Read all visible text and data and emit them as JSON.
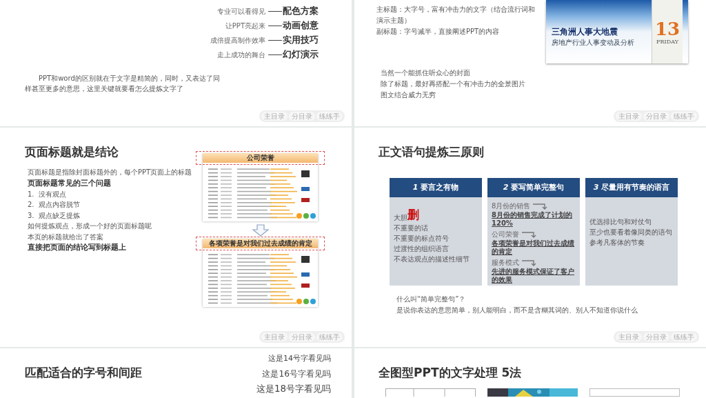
{
  "slides": [
    {
      "kind": "agenda",
      "items": [
        {
          "note": "专业可以看得见",
          "label": "配色方案"
        },
        {
          "note": "让PPT亮起来",
          "label": "动画创意"
        },
        {
          "note": "成倍提高制作效率",
          "label": "实用技巧"
        },
        {
          "note": "走上成功的舞台",
          "label": "幻灯演示"
        }
      ],
      "paragraph": "PPT和word的区别就在于文字是精简的，同时，又表达了同样甚至更多的意思，这里关键就要看怎么提炼文字了",
      "nav": [
        "主目录",
        "分目录",
        "练练手"
      ]
    },
    {
      "kind": "cover",
      "lines": [
        "主标题：大字号，富有冲击力的文字（结合流行词和演示主题）",
        "副标题：字号减半，直接阐述PPT的内容"
      ],
      "cover": {
        "title": "三角洲人事大地震",
        "subtitle": "房地产行业人事变动及分析",
        "day": "13",
        "weekday": "FRIDAY"
      },
      "notes": [
        "当然一个能抓住听众心的封面",
        "除了标题，最好再搭配一个有冲击力的全景图片",
        "图文结合威力无穷"
      ],
      "nav": [
        "主目录",
        "分目录",
        "练练手"
      ]
    },
    {
      "kind": "titles",
      "title": "页面标题就是结论",
      "lines": [
        {
          "kind": "plain",
          "text": "页面标题是指除封面标题外的，每个PPT页面上的标题"
        },
        {
          "kind": "bold",
          "text": "页面标题常见的三个问题"
        },
        {
          "kind": "list",
          "number": "1.",
          "text": "没有观点"
        },
        {
          "kind": "list",
          "number": "2.",
          "text": "观点内容脱节"
        },
        {
          "kind": "list",
          "number": "3.",
          "text": "观点缺乏提炼"
        },
        {
          "kind": "plain",
          "text": "如何提炼观点，形成一个好的页面标题呢"
        },
        {
          "kind": "plain",
          "text": "本页的标题就给出了答案"
        },
        {
          "kind": "bold",
          "text": "直接把页面的结论写到标题上"
        }
      ],
      "thumbs": [
        {
          "header": "公司荣誉"
        },
        {
          "header": "各项荣誉是对我们过去成绩的肯定"
        }
      ],
      "nav": [
        "主目录",
        "分目录",
        "练练手"
      ]
    },
    {
      "kind": "principles",
      "title": "正文语句提炼三原则",
      "cards": [
        {
          "kind": "delete",
          "number": "1",
          "heading": "要言之有物",
          "lead": "大胆",
          "mark": "删",
          "lines": [
            "不重要的话",
            "不重要的标点符号",
            "过渡性的组织语言",
            "不表达观点的描述性细节"
          ]
        },
        {
          "kind": "pairs",
          "number": "2",
          "heading": "要写简单完整句",
          "pairs": [
            {
              "before": "8月份的销售",
              "after": "8月份的销售完成了计划的120%"
            },
            {
              "before": "公司荣誉",
              "after": "各项荣誉是对我们过去成绩的肯定"
            },
            {
              "before": "服务模式",
              "after": "先进的服务模式保证了客户的效果"
            }
          ]
        },
        {
          "kind": "lines",
          "number": "3",
          "heading": "尽量用有节奏的语言",
          "lines": [
            "优选排比句和对仗句",
            "至少也要看着像同类的语句",
            "参考凡客体的节奏"
          ]
        }
      ],
      "question": "什么叫“简单完整句”？",
      "answer": "是说你表达的意思简单，别人能明白，而不是含糊其词的、别人不知道你说什么",
      "nav": [
        "主目录",
        "分目录",
        "练练手"
      ]
    },
    {
      "kind": "sizes",
      "title": "匹配适合的字号和间距",
      "samples": [
        "这是14号字看见吗",
        "这是16号字看见吗",
        "这是18号字看见吗"
      ]
    },
    {
      "kind": "photos",
      "title": "全图型PPT的文字处理 5法",
      "pictures": [
        {
          "kind": "table"
        },
        {
          "kind": "picture"
        },
        {
          "kind": "blank"
        }
      ]
    }
  ]
}
